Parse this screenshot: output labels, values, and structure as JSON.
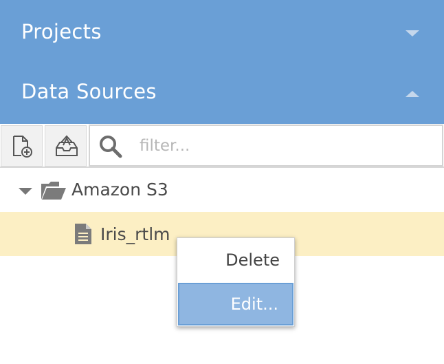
{
  "accordion": {
    "projects_label": "Projects",
    "datasources_label": "Data Sources"
  },
  "toolbar": {
    "new_icon": "new-document-icon",
    "import_icon": "inbox-import-icon",
    "search_icon": "search-icon",
    "filter_placeholder": "filter...",
    "filter_value": ""
  },
  "tree": {
    "folder": {
      "label": "Amazon S3",
      "icon": "folder-open-icon",
      "expanded": true
    },
    "items": [
      {
        "label": "Iris_rtlm",
        "icon": "document-icon",
        "selected": true
      }
    ]
  },
  "context_menu": {
    "items": [
      {
        "label": "Delete"
      },
      {
        "label": "Edit...",
        "highlighted": true
      }
    ]
  },
  "colors": {
    "header_bg": "#6a9fd6",
    "selected_row_bg": "#fcefc4",
    "menu_highlight_bg": "#8fb6e1"
  }
}
